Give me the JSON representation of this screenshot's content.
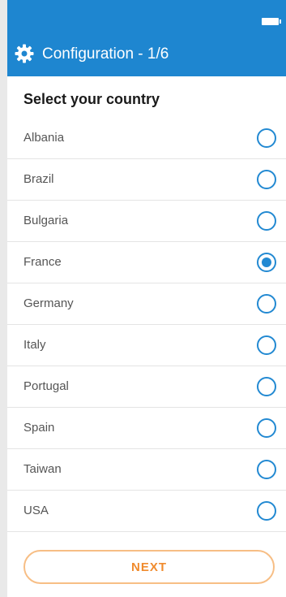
{
  "colors": {
    "primary": "#1e86d0",
    "radio": "#2289d2",
    "button_border": "#f7be85",
    "button_text": "#f08b2e"
  },
  "status_bar": {
    "battery_icon": "battery-icon"
  },
  "app_bar": {
    "icon": "gear-icon",
    "title": "Configuration - 1/6"
  },
  "section": {
    "title": "Select your country"
  },
  "countries": [
    {
      "name": "Albania",
      "selected": false
    },
    {
      "name": "Brazil",
      "selected": false
    },
    {
      "name": "Bulgaria",
      "selected": false
    },
    {
      "name": "France",
      "selected": true
    },
    {
      "name": "Germany",
      "selected": false
    },
    {
      "name": "Italy",
      "selected": false
    },
    {
      "name": "Portugal",
      "selected": false
    },
    {
      "name": "Spain",
      "selected": false
    },
    {
      "name": "Taiwan",
      "selected": false
    },
    {
      "name": "USA",
      "selected": false
    }
  ],
  "actions": {
    "next_label": "NEXT"
  }
}
